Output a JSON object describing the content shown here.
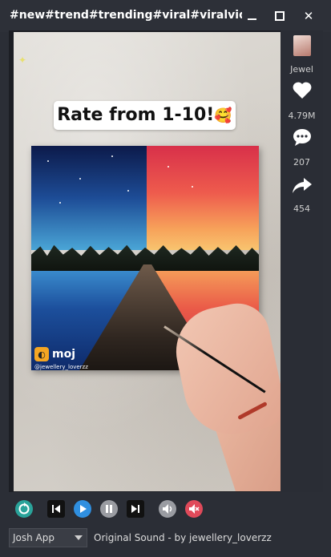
{
  "window": {
    "title": "#new#trend#trending#viral#viralvideo#..."
  },
  "video": {
    "caption": "Rate from 1-10!",
    "caption_emoji": "🥰",
    "watermark_brand": "moj",
    "watermark_handle": "@jewellery_loverzz"
  },
  "sidebar": {
    "username": "Jewel",
    "likes": "4.79M",
    "comments": "207",
    "shares": "454"
  },
  "controls": {
    "replay_icon": "replay-icon",
    "prev_icon": "skip-previous-icon",
    "play_icon": "play-icon",
    "pause_icon": "pause-icon",
    "next_icon": "skip-next-icon",
    "volume_icon": "volume-icon",
    "mute_icon": "mute-icon"
  },
  "footer": {
    "source_selected": "Josh App",
    "sound_text": "Original Sound - by jewellery_loverzz"
  },
  "colors": {
    "accent_blue": "#2f8fe0",
    "accent_teal": "#2aa39a",
    "mute_red": "#e04a5a"
  }
}
